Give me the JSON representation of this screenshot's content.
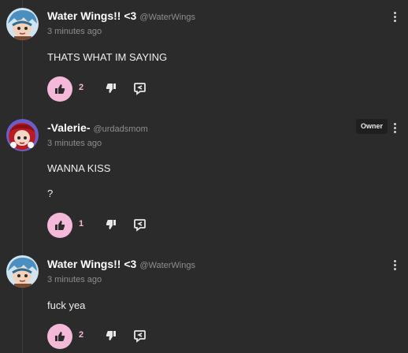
{
  "comments": [
    {
      "username": "Water Wings!! <3",
      "handle": "@WaterWings",
      "timestamp": "3 minutes ago",
      "lines": [
        "THATS WHAT IM SAYING"
      ],
      "likes": "2"
    },
    {
      "username": "-Valerie-",
      "handle": "@urdadsmom",
      "timestamp": "3 minutes ago",
      "badge": "Owner",
      "lines": [
        "WANNA KISS",
        "?"
      ],
      "likes": "1"
    },
    {
      "username": "Water Wings!! <3",
      "handle": "@WaterWings",
      "timestamp": "3 minutes ago",
      "lines": [
        "fuck yea"
      ],
      "likes": "2"
    }
  ],
  "icons": {
    "like": "thumbs-up-icon",
    "dislike": "thumbs-down-icon",
    "reply": "reply-icon",
    "menu": "more-vertical-icon"
  },
  "colors": {
    "background": "#2b2b2b",
    "accent": "#f4b8d8"
  }
}
